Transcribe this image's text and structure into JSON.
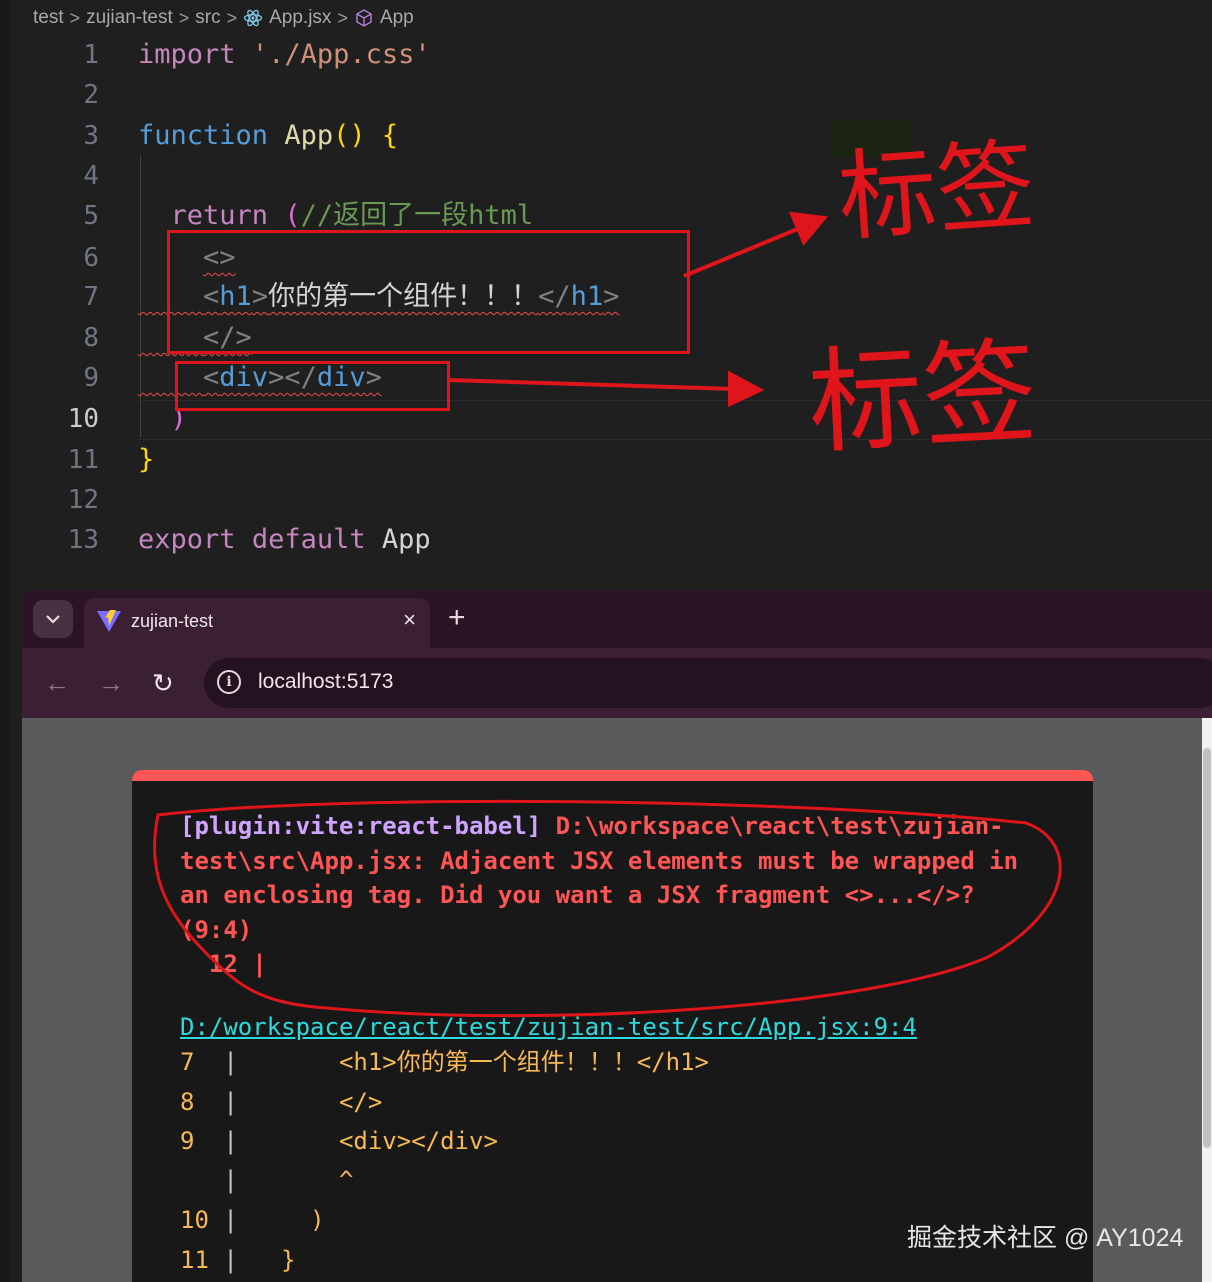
{
  "breadcrumb": {
    "items": [
      "test",
      "zujian-test",
      "src",
      "App.jsx",
      "App"
    ],
    "separator": ">"
  },
  "editor": {
    "current_line": "10",
    "line_numbers": [
      "1",
      "2",
      "3",
      "4",
      "5",
      "6",
      "7",
      "8",
      "9",
      "10",
      "11",
      "12",
      "13"
    ],
    "tokens": {
      "l1_import": "import",
      "l1_str": "'./App.css'",
      "l3_function": "function",
      "l3_name": "App",
      "l3_parens": "()",
      "l3_brace": "{",
      "l5_return": "return",
      "l5_paren": "(",
      "l5_comment": "//返回了一段html",
      "l6_open": "<>",
      "l7_open_lt": "<",
      "l7_open_tag": "h1",
      "l7_open_gt": ">",
      "l7_text": "你的第一个组件！！！",
      "l7_close_lt": "</",
      "l7_close_tag": "h1",
      "l7_close_gt": ">",
      "l8_close": "</>",
      "l9_div_open_lt": "<",
      "l9_div_open_tag": "div",
      "l9_div_mid": "></",
      "l9_div_close_tag": "div",
      "l9_div_close_gt": ">",
      "l10_paren": ")",
      "l11_brace": "}",
      "l13_export": "export",
      "l13_default": "default",
      "l13_name": "App"
    }
  },
  "annotations": {
    "label_top": "标签",
    "label_bottom": "标签"
  },
  "browser": {
    "tab_title": "zujian-test",
    "close_glyph": "×",
    "newtab_glyph": "+",
    "url": "localhost:5173",
    "nav": {
      "back": "←",
      "forward": "→",
      "reload": "↻"
    }
  },
  "error_overlay": {
    "plugin": "[plugin:vite:react-babel]",
    "message": " D:\\workspace\\react\\test\\zujian-test\\src\\App.jsx: Adjacent JSX elements must be wrapped in an enclosing tag. Did you want a JSX fragment <>...</>? (9:4)",
    "inline_frame": "  12 |",
    "file_link": "D:/workspace/react/test/zujian-test/src/App.jsx:9:4",
    "frame_lines": [
      {
        "num": "7",
        "bar": "|",
        "src": "      <h1>你的第一个组件！！！</h1>"
      },
      {
        "num": "8",
        "bar": "|",
        "src": "      </>"
      },
      {
        "num": "9",
        "bar": "|",
        "src": "      <div></div>"
      },
      {
        "num": "",
        "bar": "|",
        "src": "      ^"
      },
      {
        "num": "10",
        "bar": "|",
        "src": "    )"
      },
      {
        "num": "11",
        "bar": "|",
        "src": "  }"
      }
    ]
  },
  "watermark": "掘金技术社区 @ AY1024",
  "colors": {
    "error_red": "#ff5555",
    "annotation_red": "#e0141b",
    "link_cyan": "#2dd9da",
    "frame_orange": "#f7b955"
  }
}
